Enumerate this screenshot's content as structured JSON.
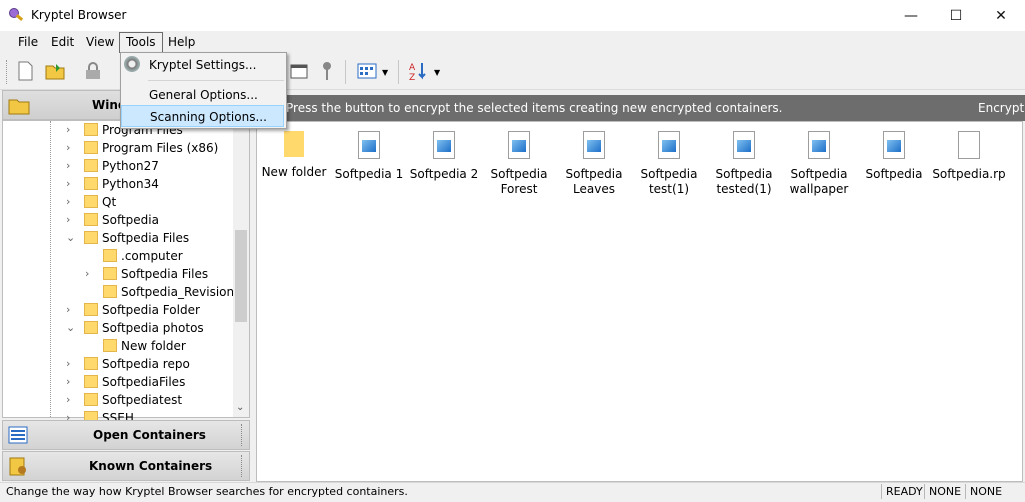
{
  "window": {
    "title": "Kryptel Browser",
    "min_glyph": "—",
    "max_glyph": "☐",
    "close_glyph": "✕"
  },
  "menubar": {
    "items": [
      "File",
      "Edit",
      "View",
      "Tools",
      "Help"
    ]
  },
  "tools_menu": {
    "items": [
      "Kryptel Settings...",
      "General Options...",
      "Scanning Options..."
    ],
    "highlighted": "Scanning Options..."
  },
  "left_pane": {
    "header_label": "Wind",
    "tree": [
      {
        "label": "Program Files",
        "level": 1,
        "expander": "›"
      },
      {
        "label": "Program Files (x86)",
        "level": 1,
        "expander": "›"
      },
      {
        "label": "Python27",
        "level": 1,
        "expander": "›"
      },
      {
        "label": "Python34",
        "level": 1,
        "expander": "›"
      },
      {
        "label": "Qt",
        "level": 1,
        "expander": "›"
      },
      {
        "label": "Softpedia",
        "level": 1,
        "expander": "›"
      },
      {
        "label": "Softpedia Files",
        "level": 1,
        "expander": "⌄"
      },
      {
        "label": ".computer",
        "level": 2,
        "expander": ""
      },
      {
        "label": "Softpedia Files",
        "level": 2,
        "expander": "›"
      },
      {
        "label": "Softpedia_Revisions",
        "level": 2,
        "expander": ""
      },
      {
        "label": "Softpedia Folder",
        "level": 1,
        "expander": "›"
      },
      {
        "label": "Softpedia photos",
        "level": 1,
        "expander": "⌄"
      },
      {
        "label": "New folder",
        "level": 2,
        "expander": ""
      },
      {
        "label": "Softpedia repo",
        "level": 1,
        "expander": "›"
      },
      {
        "label": "SoftpediaFiles",
        "level": 1,
        "expander": "›"
      },
      {
        "label": "Softpediatest",
        "level": 1,
        "expander": "›"
      },
      {
        "label": "SSEH",
        "level": 1,
        "expander": "›"
      }
    ],
    "scroll_up": "⌃",
    "scroll_down": "⌄",
    "panels": [
      "Open Containers",
      "Known Containers"
    ]
  },
  "right_pane": {
    "message": "Press the button to encrypt the selected items creating new encrypted containers.",
    "action": "Encrypt",
    "files": [
      {
        "name": "New folder",
        "kind": "folder"
      },
      {
        "name": "Softpedia 1",
        "kind": "image"
      },
      {
        "name": "Softpedia 2",
        "kind": "image"
      },
      {
        "name": "Softpedia Forest",
        "kind": "image"
      },
      {
        "name": "Softpedia Leaves",
        "kind": "image"
      },
      {
        "name": "Softpedia test(1)",
        "kind": "image"
      },
      {
        "name": "Softpedia tested(1)",
        "kind": "image"
      },
      {
        "name": "Softpedia wallpaper",
        "kind": "image"
      },
      {
        "name": "Softpedia",
        "kind": "image"
      },
      {
        "name": "Softpedia.rp",
        "kind": "file"
      }
    ]
  },
  "statusbar": {
    "text": "Change the way how Kryptel Browser searches for encrypted containers.",
    "cells": [
      "READY",
      "NONE",
      "NONE"
    ]
  },
  "colors": {
    "header_bg": "#6d6d6d",
    "highlight": "#cce8ff",
    "folder": "#ffd96b"
  }
}
